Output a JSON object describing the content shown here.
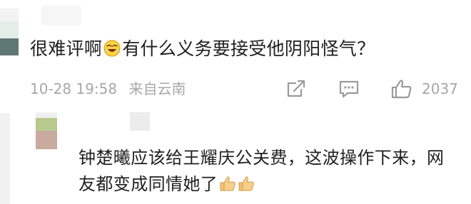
{
  "top_comment": {
    "text_before_emoji": "很难评啊",
    "emoji": "laugh-cry-emoji",
    "text_after_emoji": "有什么义务要接受他阴阳怪气？",
    "time": "10-28 19:58",
    "location": "来自云南",
    "like_count": "2037"
  },
  "reply": {
    "text": "钟楚曦应该给王耀庆公关费，这波操作下来，网友都变成同情她了",
    "emoji": "thumbs-up-emoji",
    "emoji_count": 2
  },
  "colors": {
    "text": "#1f1f1f",
    "meta": "#a7a7a7",
    "avatar_green": "#b7c98b",
    "avatar_pink": "#c9aa9f",
    "avatar_teal": "#5f7774"
  }
}
